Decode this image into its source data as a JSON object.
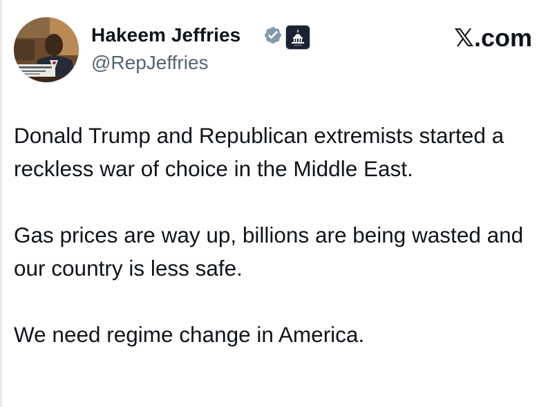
{
  "author": {
    "display_name": "Hakeem Jeffries",
    "handle": "@RepJeffries",
    "avatar_icon": "profile-photo",
    "verified_icon": "verified-badge-icon",
    "affiliation_icon": "capitol-icon",
    "verified_color": "#829aab"
  },
  "site": {
    "label": "𝕏.com"
  },
  "tweet": {
    "paragraphs": [
      "Donald Trump and Republican extremists started a reckless war of choice in the Middle East.",
      "Gas prices are way up, billions are being wasted and our country is less safe.",
      "We need regime change in America."
    ]
  }
}
